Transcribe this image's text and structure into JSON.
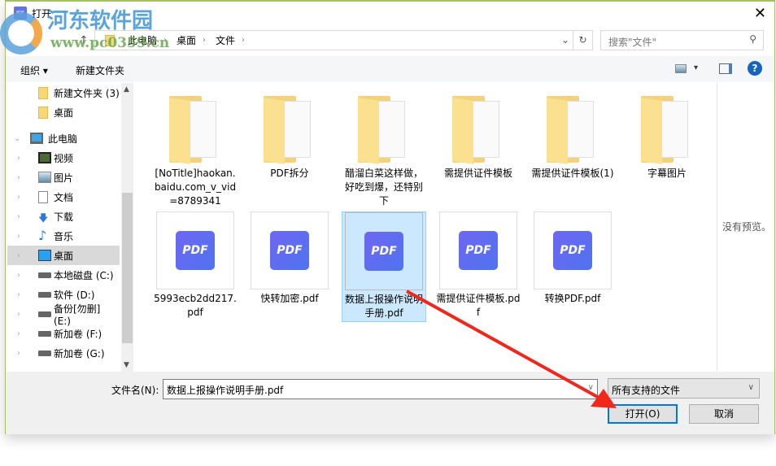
{
  "window": {
    "title": "打开",
    "close": "✕"
  },
  "watermark": {
    "name": "河东软件园",
    "url": "www.pc0359.cn"
  },
  "address": {
    "crumbs": [
      "此电脑",
      "桌面",
      "文件"
    ],
    "dropdown": "⌄",
    "refresh": "↻",
    "up": "↑"
  },
  "search": {
    "placeholder": "搜索\"文件\"",
    "icon": "⚲"
  },
  "toolbar": {
    "organize": "组织 ▾",
    "new_folder": "新建文件夹",
    "view": "▾",
    "help": "?"
  },
  "nav": {
    "items": [
      {
        "label": "新建文件夹 (3)",
        "icon": "folder"
      },
      {
        "label": "桌面",
        "icon": "folder"
      },
      {
        "label": "此电脑",
        "icon": "computer",
        "expanded": true
      },
      {
        "label": "视频",
        "icon": "video"
      },
      {
        "label": "图片",
        "icon": "picture"
      },
      {
        "label": "文档",
        "icon": "document"
      },
      {
        "label": "下载",
        "icon": "download"
      },
      {
        "label": "音乐",
        "icon": "music"
      },
      {
        "label": "桌面",
        "icon": "desktop",
        "selected": true
      },
      {
        "label": "本地磁盘 (C:)",
        "icon": "drive"
      },
      {
        "label": "软件 (D:)",
        "icon": "drive"
      },
      {
        "label": "备份[勿删] (E:)",
        "icon": "drive"
      },
      {
        "label": "新加卷 (F:)",
        "icon": "drive"
      },
      {
        "label": "新加卷 (G:)",
        "icon": "drive"
      }
    ]
  },
  "files": [
    {
      "name": "[NoTitle]haokan.baidu.com_v_vid=8789341",
      "type": "folder"
    },
    {
      "name": "PDF拆分",
      "type": "folder"
    },
    {
      "name": "醋溜白菜这样做，好吃到爆，还特别下",
      "type": "folder"
    },
    {
      "name": "需提供证件模板",
      "type": "folder"
    },
    {
      "name": "需提供证件模板(1)",
      "type": "folder"
    },
    {
      "name": "字幕图片",
      "type": "folder"
    },
    {
      "name": "5993ecb2dd217.pdf",
      "type": "pdf"
    },
    {
      "name": "快转加密.pdf",
      "type": "pdf"
    },
    {
      "name": "数据上报操作说明手册.pdf",
      "type": "pdf",
      "selected": true
    },
    {
      "name": "需提供证件模板.pdf",
      "type": "pdf"
    },
    {
      "name": "转换PDF.pdf",
      "type": "pdf"
    }
  ],
  "pdf_icon_text": "PDF",
  "preview": {
    "text": "没有预览。"
  },
  "bottom": {
    "filename_label": "文件名(N):",
    "filename_value": "数据上报操作说明手册.pdf",
    "filetype": "所有支持的文件",
    "open": "打开(O)",
    "cancel": "取消"
  }
}
